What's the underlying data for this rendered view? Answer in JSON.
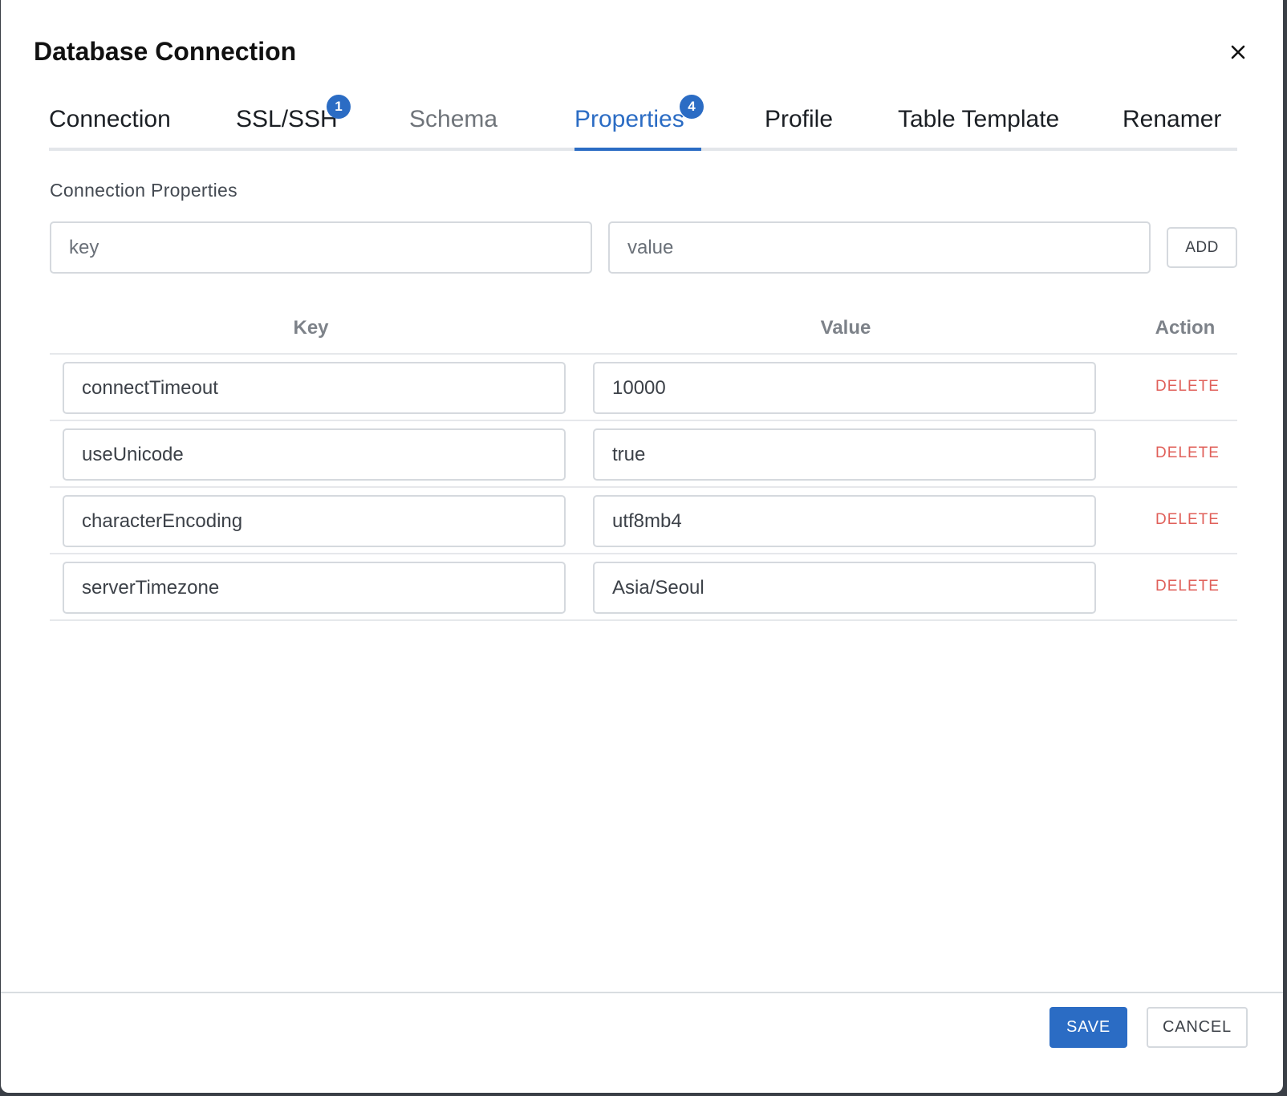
{
  "dialog": {
    "title": "Database Connection"
  },
  "tabs": [
    {
      "label": "Connection",
      "state": "normal"
    },
    {
      "label": "SSL/SSH",
      "state": "normal",
      "badge": "1"
    },
    {
      "label": "Schema",
      "state": "disabled"
    },
    {
      "label": "Properties",
      "state": "active",
      "badge": "4"
    },
    {
      "label": "Profile",
      "state": "normal"
    },
    {
      "label": "Table Template",
      "state": "normal"
    },
    {
      "label": "Renamer",
      "state": "normal"
    }
  ],
  "properties": {
    "section_label": "Connection Properties",
    "new_key_placeholder": "key",
    "new_value_placeholder": "value",
    "add_label": "ADD",
    "columns": {
      "key": "Key",
      "value": "Value",
      "action": "Action"
    },
    "rows": [
      {
        "key": "connectTimeout",
        "value": "10000",
        "action": "DELETE"
      },
      {
        "key": "useUnicode",
        "value": "true",
        "action": "DELETE"
      },
      {
        "key": "characterEncoding",
        "value": "utf8mb4",
        "action": "DELETE"
      },
      {
        "key": "serverTimezone",
        "value": "Asia/Seoul",
        "action": "DELETE"
      }
    ]
  },
  "footer": {
    "save_label": "SAVE",
    "cancel_label": "CANCEL"
  },
  "colors": {
    "accent": "#2b6cc4",
    "danger": "#e0605a",
    "border": "#d5d9de"
  },
  "icons": {
    "close": "close-icon"
  }
}
